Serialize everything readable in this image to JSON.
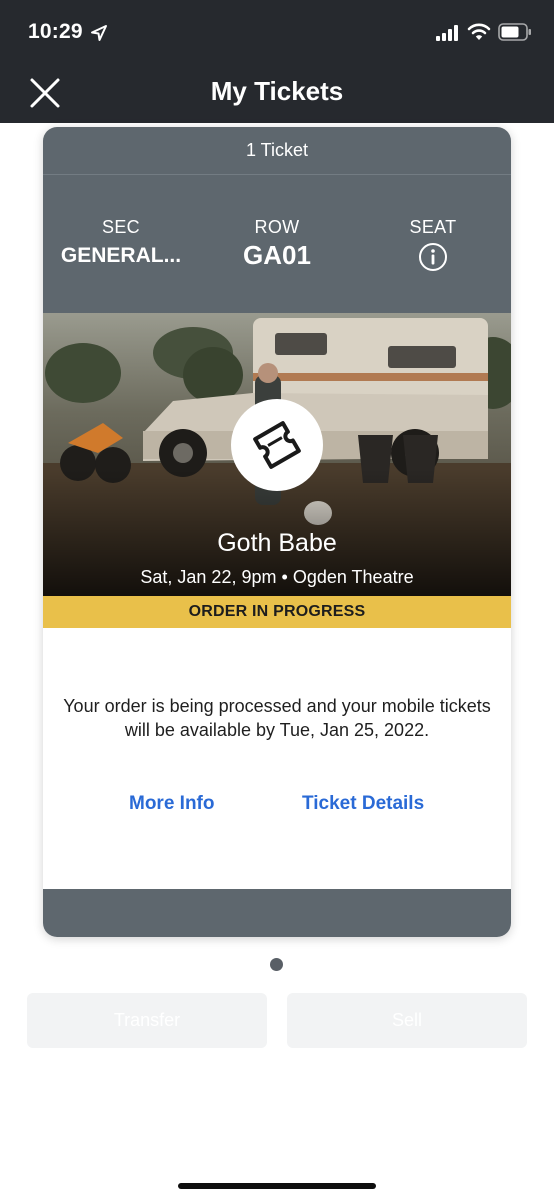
{
  "status_bar": {
    "time": "10:29",
    "icons": [
      "location-arrow-icon",
      "cellular-signal-icon",
      "wifi-icon",
      "battery-icon"
    ]
  },
  "header": {
    "title": "My Tickets",
    "close_icon": "close-icon"
  },
  "ticket": {
    "count_label": "1 Ticket",
    "section": {
      "label": "SEC",
      "value": "GENERAL..."
    },
    "row": {
      "label": "ROW",
      "value": "GA01"
    },
    "seat": {
      "label": "SEAT",
      "icon": "info-icon"
    },
    "event": {
      "name": "Goth Babe",
      "date_time": "Sat, Jan 22, 9pm",
      "separator": "•",
      "venue": "Ogden Theatre"
    },
    "status": "ORDER IN PROGRESS",
    "message": "Your order is being processed and your mobile tickets will be available by Tue, Jan 25, 2022.",
    "links": {
      "more_info": "More Info",
      "ticket_details": "Ticket Details"
    }
  },
  "pager": {
    "pages": 1,
    "current": 1
  },
  "actions": {
    "transfer": "Transfer",
    "sell": "Sell"
  },
  "colors": {
    "header_bg": "#26292e",
    "card_panel": "#5e676e",
    "status_strip": "#e9c04a",
    "link": "#2a6ad6"
  }
}
